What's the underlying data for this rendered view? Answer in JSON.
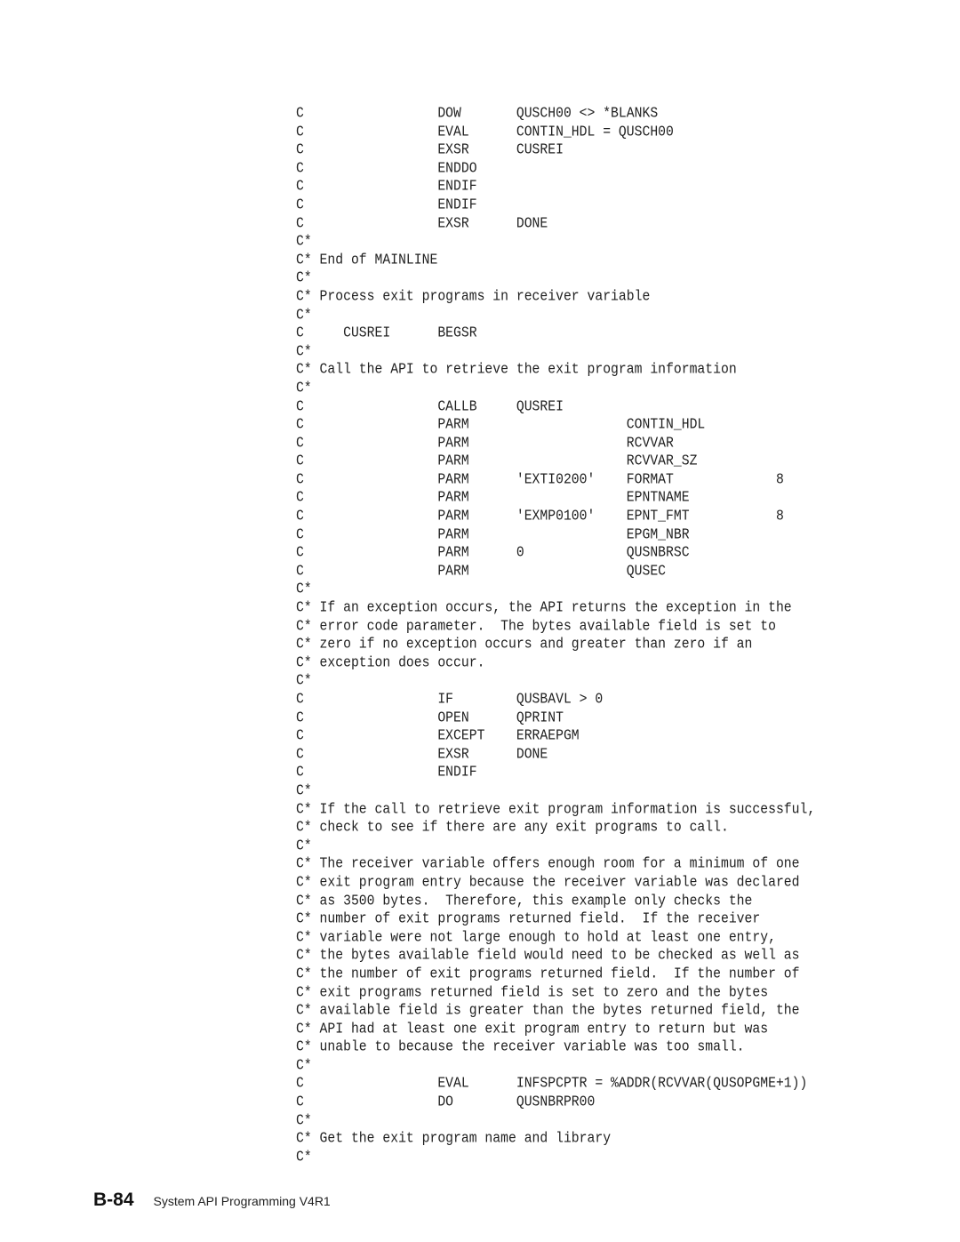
{
  "code_listing": {
    "lines": [
      "C                 DOW       QUSCH00 <> *BLANKS",
      "C                 EVAL      CONTIN_HDL = QUSCH00",
      "C                 EXSR      CUSREI",
      "C                 ENDDO",
      "C                 ENDIF",
      "C                 ENDIF",
      "C                 EXSR      DONE",
      "C*",
      "C* End of MAINLINE",
      "C*",
      "C* Process exit programs in receiver variable",
      "C*",
      "C     CUSREI      BEGSR",
      "C*",
      "C* Call the API to retrieve the exit program information",
      "C*",
      "C                 CALLB     QUSREI",
      "C                 PARM                    CONTIN_HDL",
      "C                 PARM                    RCVVAR",
      "C                 PARM                    RCVVAR_SZ",
      "C                 PARM      'EXTI0200'    FORMAT             8",
      "C                 PARM                    EPNTNAME",
      "C                 PARM      'EXMP0100'    EPNT_FMT           8",
      "C                 PARM                    EPGM_NBR",
      "C                 PARM      0             QUSNBRSC",
      "C                 PARM                    QUSEC",
      "C*",
      "C* If an exception occurs, the API returns the exception in the",
      "C* error code parameter.  The bytes available field is set to",
      "C* zero if no exception occurs and greater than zero if an",
      "C* exception does occur.",
      "C*",
      "C                 IF        QUSBAVL > 0",
      "C                 OPEN      QPRINT",
      "C                 EXCEPT    ERRAEPGM",
      "C                 EXSR      DONE",
      "C                 ENDIF",
      "C*",
      "C* If the call to retrieve exit program information is successful,",
      "C* check to see if there are any exit programs to call.",
      "C*",
      "C* The receiver variable offers enough room for a minimum of one",
      "C* exit program entry because the receiver variable was declared",
      "C* as 3500 bytes.  Therefore, this example only checks the",
      "C* number of exit programs returned field.  If the receiver",
      "C* variable were not large enough to hold at least one entry,",
      "C* the bytes available field would need to be checked as well as",
      "C* the number of exit programs returned field.  If the number of",
      "C* exit programs returned field is set to zero and the bytes",
      "C* available field is greater than the bytes returned field, the",
      "C* API had at least one exit program entry to return but was",
      "C* unable to because the receiver variable was too small.",
      "C*",
      "C                 EVAL      INFSPCPTR = %ADDR(RCVVAR(QUSOPGME+1))",
      "C                 DO        QUSNBRPR00",
      "C*",
      "C* Get the exit program name and library",
      "C*"
    ]
  },
  "footer": {
    "page_number": "B-84",
    "book_title": "System API Programming V4R1"
  }
}
